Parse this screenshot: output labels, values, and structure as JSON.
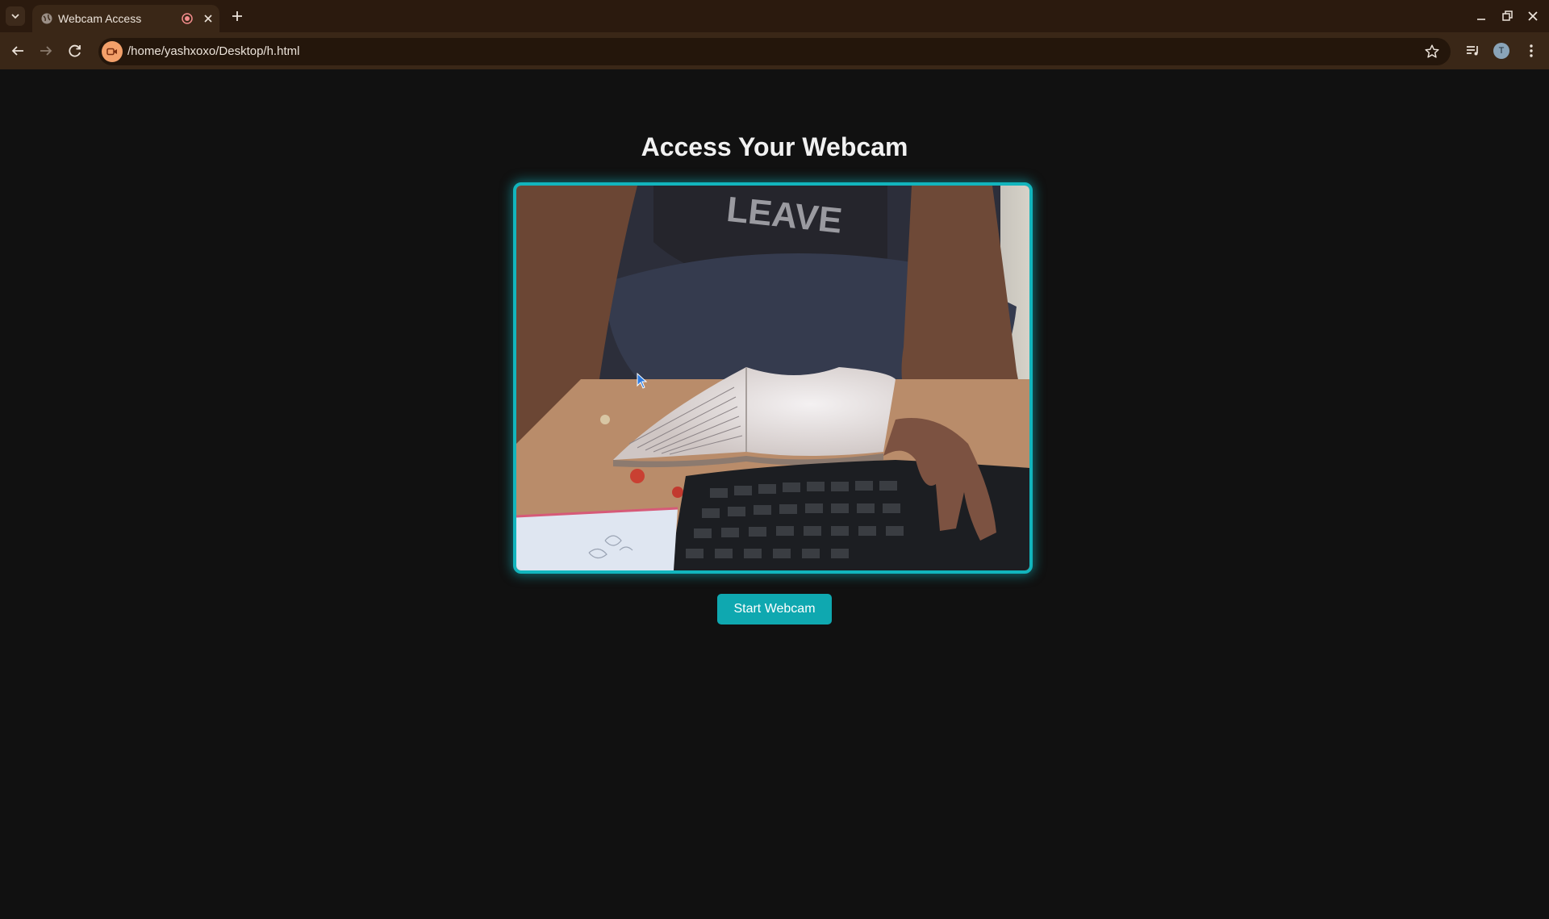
{
  "browser": {
    "tab": {
      "title": "Webcam Access"
    },
    "address_bar": {
      "url": "/home/yashxoxo/Desktop/h.html"
    },
    "profile_initial": "T",
    "icons": {
      "tab_search": "chevron-down-icon",
      "favicon": "globe-icon",
      "recording": "recording-icon",
      "close_tab": "close-icon",
      "new_tab": "plus-icon",
      "back": "back-arrow-icon",
      "forward": "forward-arrow-icon",
      "reload": "reload-icon",
      "camera_in_use": "camera-icon",
      "bookmark": "star-icon",
      "media_controls": "media-queue-icon",
      "menu": "kebab-menu-icon"
    }
  },
  "page": {
    "heading": "Access Your Webcam",
    "video": {
      "content": "live-webcam-feed",
      "border_color": "#12b5bd"
    },
    "start_button": {
      "label": "Start Webcam",
      "color": "#0fa8b0"
    }
  },
  "colors": {
    "page_background": "#111111",
    "chrome_background": "#2b1a0e",
    "toolbar_background": "#3a2717",
    "accent": "#12b5bd"
  }
}
